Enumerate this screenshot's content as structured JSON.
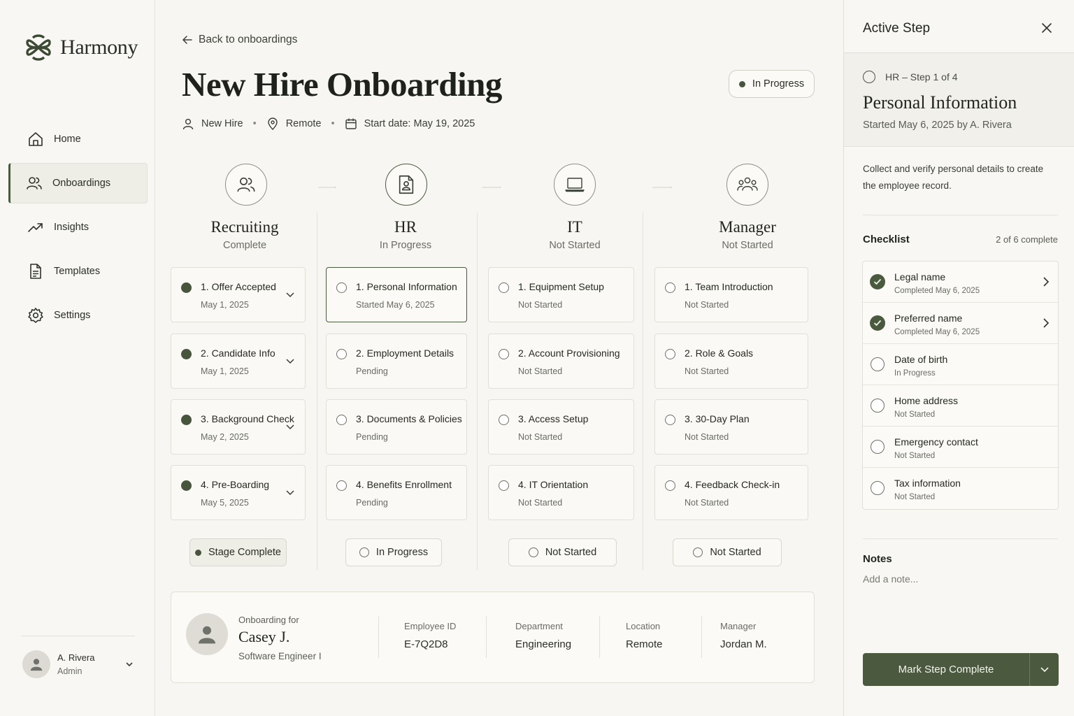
{
  "app": {
    "name": "Harmony"
  },
  "sidebar": {
    "items": [
      {
        "label": "Home",
        "icon": "home-icon",
        "active": false
      },
      {
        "label": "Onboardings",
        "icon": "users-icon",
        "active": true
      },
      {
        "label": "Insights",
        "icon": "trend-icon",
        "active": false
      },
      {
        "label": "Templates",
        "icon": "document-icon",
        "active": false
      },
      {
        "label": "Settings",
        "icon": "gear-icon",
        "active": false
      }
    ],
    "user": {
      "name": "A. Rivera",
      "role": "Admin"
    }
  },
  "header": {
    "back_label": "Back to onboardings",
    "title": "New Hire Onboarding",
    "status": "In Progress",
    "meta": {
      "role": "New Hire",
      "location": "Remote",
      "start": "Start date: May 19, 2025"
    }
  },
  "stages": [
    {
      "name": "Recruiting",
      "status": "Complete",
      "icon": "users-icon",
      "button": "Stage Complete",
      "tasks": [
        {
          "title": "1. Offer Accepted",
          "sub": "May 1, 2025",
          "done": true
        },
        {
          "title": "2. Candidate Info",
          "sub": "May 1, 2025",
          "done": true
        },
        {
          "title": "3. Background Check",
          "sub": "May 2, 2025",
          "done": true
        },
        {
          "title": "4. Pre-Boarding",
          "sub": "May 5, 2025",
          "done": true
        }
      ]
    },
    {
      "name": "HR",
      "status": "In Progress",
      "icon": "id-badge-icon",
      "button": "In Progress",
      "tasks": [
        {
          "title": "1. Personal Information",
          "sub": "Started May 6, 2025",
          "done": false
        },
        {
          "title": "2. Employment Details",
          "sub": "Pending",
          "done": false
        },
        {
          "title": "3. Documents & Policies",
          "sub": "Pending",
          "done": false
        },
        {
          "title": "4. Benefits Enrollment",
          "sub": "Pending",
          "done": false
        }
      ]
    },
    {
      "name": "IT",
      "status": "Not Started",
      "icon": "laptop-icon",
      "button": "Not Started",
      "tasks": [
        {
          "title": "1. Equipment Setup",
          "sub": "Not Started",
          "done": false
        },
        {
          "title": "2. Account Provisioning",
          "sub": "Not Started",
          "done": false
        },
        {
          "title": "3. Access Setup",
          "sub": "Not Started",
          "done": false
        },
        {
          "title": "4. IT Orientation",
          "sub": "Not Started",
          "done": false
        }
      ]
    },
    {
      "name": "Manager",
      "status": "Not Started",
      "icon": "team-icon",
      "button": "Not Started",
      "tasks": [
        {
          "title": "1. Team Introduction",
          "sub": "Not Started",
          "done": false
        },
        {
          "title": "2. Role & Goals",
          "sub": "Not Started",
          "done": false
        },
        {
          "title": "3. 30-Day Plan",
          "sub": "Not Started",
          "done": false
        },
        {
          "title": "4. Feedback Check-in",
          "sub": "Not Started",
          "done": false
        }
      ]
    }
  ],
  "employee": {
    "for_label": "Onboarding for",
    "name": "Casey J.",
    "role": "Software Engineer I",
    "fields": [
      {
        "label": "Employee ID",
        "value": "E-7Q2D8"
      },
      {
        "label": "Department",
        "value": "Engineering"
      },
      {
        "label": "Location",
        "value": "Remote"
      },
      {
        "label": "Manager",
        "value": "Jordan M."
      }
    ]
  },
  "panel": {
    "title": "Active Step",
    "step_kicker": "HR – Step 1 of 4",
    "step_title": "Personal Information",
    "step_meta": "Started May 6, 2025 by A. Rivera",
    "description": "Collect and verify personal details to create the employee record.",
    "checklist_label": "Checklist",
    "checklist_count": "2 of 6 complete",
    "checklist": [
      {
        "label": "Legal name",
        "sub": "Completed May 6, 2025",
        "done": true
      },
      {
        "label": "Preferred name",
        "sub": "Completed May 6, 2025",
        "done": true
      },
      {
        "label": "Date of birth",
        "sub": "In Progress",
        "done": false
      },
      {
        "label": "Home address",
        "sub": "Not Started",
        "done": false
      },
      {
        "label": "Emergency contact",
        "sub": "Not Started",
        "done": false
      },
      {
        "label": "Tax information",
        "sub": "Not Started",
        "done": false
      }
    ],
    "notes_label": "Notes",
    "notes_placeholder": "Add a note...",
    "primary_button": "Mark Step Complete"
  },
  "colors": {
    "accent": "#4a5a3e",
    "background": "#f7f6f2",
    "border": "#e1dfd6"
  }
}
